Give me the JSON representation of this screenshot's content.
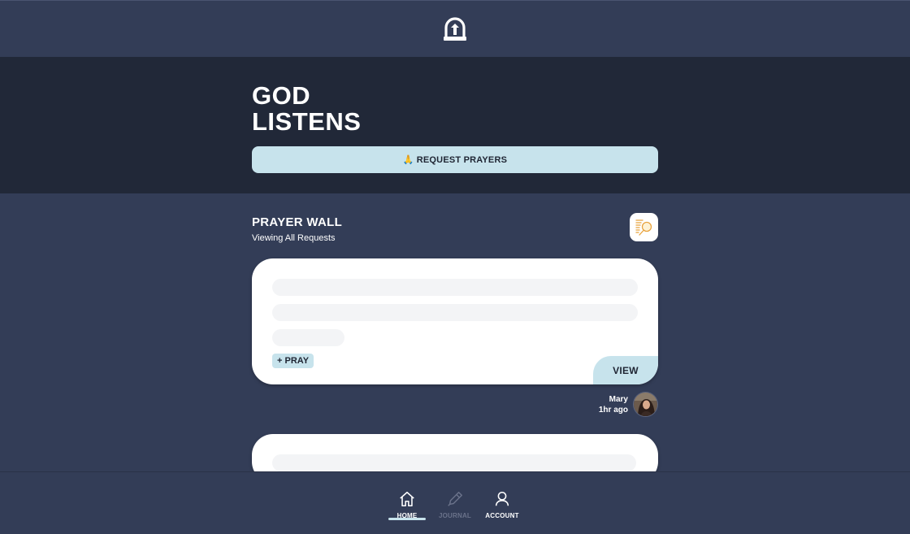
{
  "hero": {
    "title": "GOD LISTENS",
    "request_button": {
      "emoji": "🙏",
      "label": "REQUEST PRAYERS"
    }
  },
  "wall": {
    "title": "PRAYER WALL",
    "subtitle": "Viewing All Requests",
    "filter_icon": "search-list-icon"
  },
  "cards": [
    {
      "pray_label": "+ PRAY",
      "view_label": "VIEW",
      "author": "Mary",
      "time": "1hr ago"
    }
  ],
  "nav": {
    "items": [
      {
        "label": "HOME",
        "icon": "home-icon",
        "active": true
      },
      {
        "label": "JOURNAL",
        "icon": "pen-icon",
        "active": false
      },
      {
        "label": "ACCOUNT",
        "icon": "user-icon",
        "active": false
      }
    ]
  },
  "colors": {
    "background": "#333d57",
    "hero_background": "#212838",
    "accent": "#c7e3ec",
    "card": "#ffffff",
    "skeleton": "#f3f4f6",
    "icon_orange": "#e8a23a"
  }
}
